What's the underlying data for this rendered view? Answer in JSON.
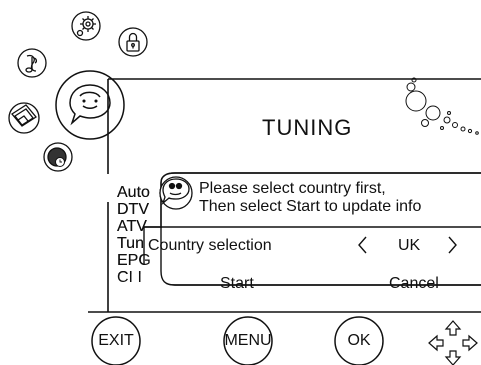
{
  "screen": {
    "title": "TUNING"
  },
  "menu_items": [
    "Auto",
    "DTV",
    "ATV",
    "Tun",
    "EPG",
    "CI I"
  ],
  "dialog": {
    "message_line1": "Please select country first,",
    "message_line2": "Then select Start to update info",
    "country_label": "Country selection",
    "country_value": "UK",
    "start_label": "Start",
    "cancel_label": "Cancel"
  },
  "bottom_buttons": {
    "exit": "EXIT",
    "menu": "MENU",
    "ok": "OK"
  },
  "side_icons": [
    "settings-gear-icon",
    "lock-icon",
    "music-note-icon",
    "picture-icon",
    "user-face-icon",
    "timer-clock-icon"
  ]
}
